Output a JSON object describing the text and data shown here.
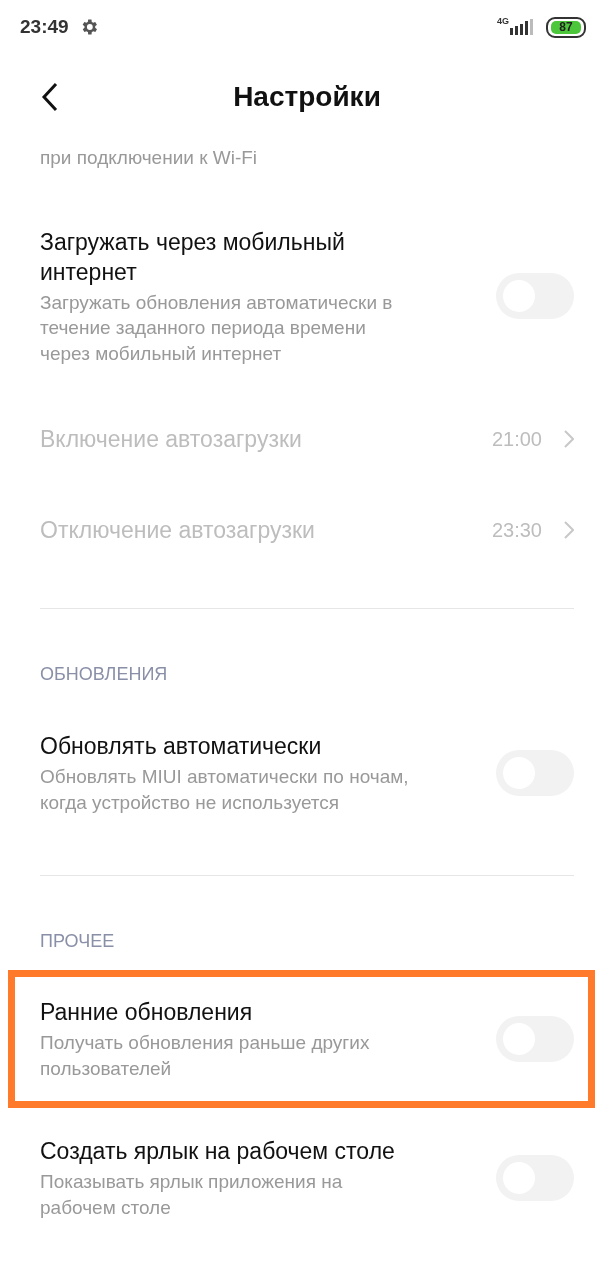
{
  "status_bar": {
    "time": "23:49",
    "network": "4G",
    "battery": "87"
  },
  "header": {
    "title": "Настройки"
  },
  "items": [
    {
      "kind": "partial",
      "subtitle": "при подключении к Wi-Fi"
    },
    {
      "kind": "toggle",
      "title": "Загружать через мобильный интернет",
      "subtitle": "Загружать обновления автоматически в течение заданного периода времени через мобильный интернет",
      "on": false,
      "highlighted": false
    },
    {
      "kind": "link",
      "title": "Включение автозагрузки",
      "value": "21:00",
      "disabled": true
    },
    {
      "kind": "link",
      "title": "Отключение автозагрузки",
      "value": "23:30",
      "disabled": true
    },
    {
      "kind": "divider"
    },
    {
      "kind": "section",
      "title": "ОБНОВЛЕНИЯ"
    },
    {
      "kind": "toggle",
      "title": "Обновлять автоматически",
      "subtitle": "Обновлять MIUI автоматически по ночам, когда устройство не используется",
      "on": false,
      "highlighted": false
    },
    {
      "kind": "divider"
    },
    {
      "kind": "section",
      "title": "ПРОЧЕЕ"
    },
    {
      "kind": "toggle",
      "title": "Ранние обновления",
      "subtitle": "Получать обновления раньше других пользователей",
      "on": false,
      "highlighted": true
    },
    {
      "kind": "toggle",
      "title": "Создать ярлык на рабочем столе",
      "subtitle": "Показывать ярлык приложения на рабочем столе",
      "on": false,
      "highlighted": false
    }
  ]
}
